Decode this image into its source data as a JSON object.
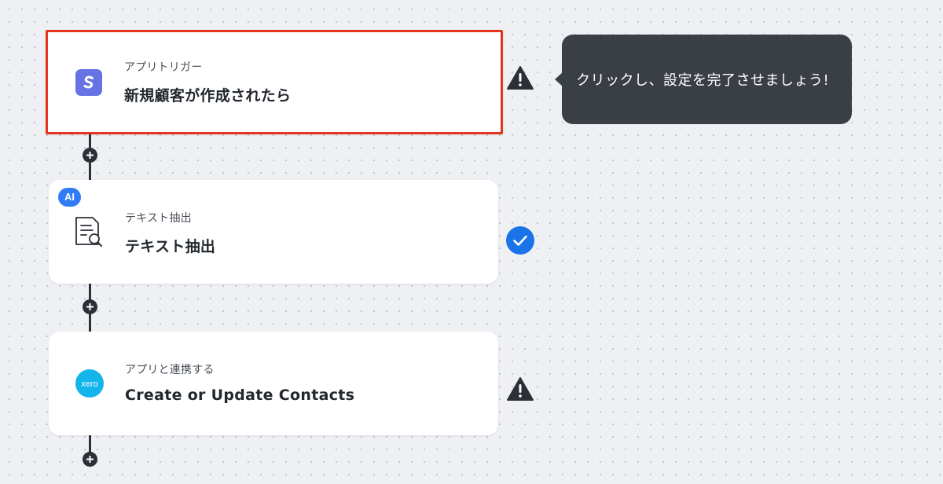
{
  "flow": {
    "steps": [
      {
        "subtitle": "アプリトリガー",
        "title": "新規顧客が作成されたら",
        "app_icon": "stripe-s-icon",
        "status": "warning",
        "selected": true
      },
      {
        "badge": "AI",
        "subtitle": "テキスト抽出",
        "title": "テキスト抽出",
        "app_icon": "document-search-icon",
        "status": "complete"
      },
      {
        "subtitle": "アプリと連携する",
        "title": "Create or Update Contacts",
        "app_icon": "xero-icon",
        "app_icon_text": "xero",
        "status": "warning"
      }
    ]
  },
  "tooltip": {
    "text": "クリックし、設定を完了させましょう!"
  },
  "colors": {
    "selected_border": "#e8341c",
    "stripe": "#6772e5",
    "xero": "#13b5ea",
    "check": "#1a73e8",
    "warning": "#2b2f36",
    "tooltip_bg": "#3a3e45",
    "ai_badge": "#2f7cf6"
  }
}
